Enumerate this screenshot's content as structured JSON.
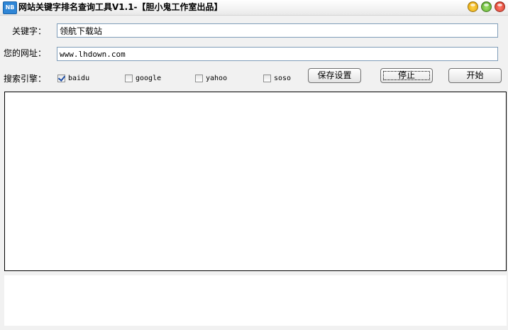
{
  "window": {
    "title": "网站关键字排名查询工具V1.1-【胆小鬼工作室出品】",
    "icon_text": "NB"
  },
  "form": {
    "keyword_label": "关键字：",
    "keyword_value": "领航下载站",
    "url_label": "您的网址：",
    "url_value": "www.lhdown.com",
    "engine_label": "搜索引擎："
  },
  "engines": [
    {
      "label": "baidu",
      "checked": true
    },
    {
      "label": "google",
      "checked": false
    },
    {
      "label": "yahoo",
      "checked": false
    },
    {
      "label": "soso",
      "checked": false
    }
  ],
  "buttons": {
    "save_label": "保存设置",
    "stop_label": "停止",
    "start_label": "开始"
  },
  "colors": {
    "window_bg": "#f1f1f1",
    "input_border": "#7f9db9",
    "checkmark": "#1f4fa7"
  }
}
